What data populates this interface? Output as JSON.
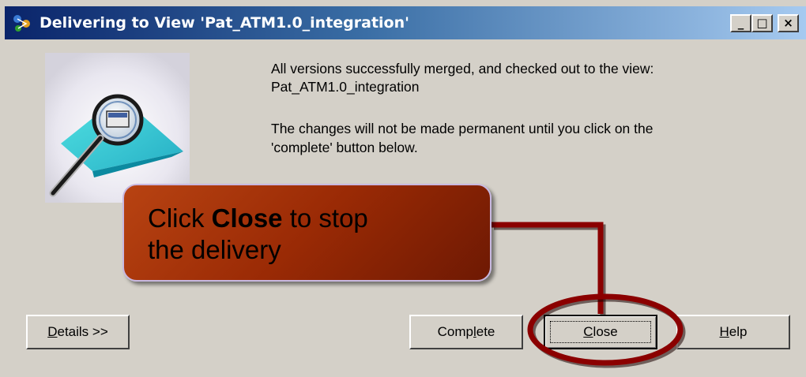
{
  "window": {
    "title": "Delivering to View 'Pat_ATM1.0_integration'",
    "controls": {
      "minimize": "_",
      "maximize": "□",
      "close": "×"
    }
  },
  "message": {
    "line1": "All versions successfully merged, and checked out to the view:",
    "line2": "Pat_ATM1.0_integration",
    "line3": "The changes will not be made permanent until you click on the",
    "line4": "'complete' button below."
  },
  "buttons": {
    "details": {
      "mnemonic": "D",
      "rest": "etails >>"
    },
    "complete": {
      "pre": "Comp",
      "mnemonic": "l",
      "rest": "ete"
    },
    "close": {
      "mnemonic": "C",
      "rest": "lose"
    },
    "help": {
      "mnemonic": "H",
      "rest": "elp"
    }
  },
  "callout": {
    "prefix": "Click ",
    "bold": "Close",
    "suffix": " to stop",
    "line2": "the delivery"
  },
  "colors": {
    "dialog_bg": "#d4d0c8",
    "title_gradient_start": "#0a246a",
    "callout_fill": "#9a2a05",
    "highlight_ring": "#8b0000"
  },
  "icons": {
    "title": "clearcase-deliver-icon",
    "illustration": "magnifying-glass-view-icon"
  }
}
